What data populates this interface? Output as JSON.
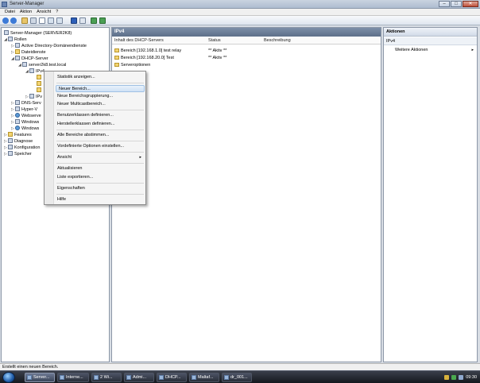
{
  "window": {
    "title": "Server-Manager"
  },
  "menubar": [
    "Datei",
    "Aktion",
    "Ansicht",
    "?"
  ],
  "tree": {
    "items": [
      {
        "label": "Server-Manager (SERVER2K8)",
        "level": 0,
        "icon": "server-icon",
        "expander": ""
      },
      {
        "label": "Rollen",
        "level": 1,
        "icon": "roles-icon",
        "expander": "◢"
      },
      {
        "label": "Active Directory-Domänendienste",
        "level": 2,
        "icon": "ad-icon",
        "expander": "▷"
      },
      {
        "label": "Dateidienste",
        "level": 2,
        "icon": "folder-icon",
        "expander": "▷"
      },
      {
        "label": "DHCP-Server",
        "level": 2,
        "icon": "dhcp-icon",
        "expander": "◢"
      },
      {
        "label": "server2k8.test.local",
        "level": 3,
        "icon": "computer-icon",
        "expander": "◢"
      },
      {
        "label": "IPv4",
        "level": 4,
        "icon": "ipv4-icon",
        "expander": "◢"
      },
      {
        "label": "IPv",
        "level": 4,
        "icon": "ipv6-icon",
        "expander": "▷"
      },
      {
        "label": "DNS-Serv",
        "level": 2,
        "icon": "dns-icon",
        "expander": "▷"
      },
      {
        "label": "Hyper-V",
        "level": 2,
        "icon": "hyperv-icon",
        "expander": "▷"
      },
      {
        "label": "Webserve",
        "level": 2,
        "icon": "web-icon",
        "expander": "▷"
      },
      {
        "label": "Windows",
        "level": 2,
        "icon": "windows-icon",
        "expander": "▷"
      },
      {
        "label": "Windows",
        "level": 2,
        "icon": "windows-icon",
        "expander": "▷"
      },
      {
        "label": "Features",
        "level": 1,
        "icon": "features-icon",
        "expander": "▷"
      },
      {
        "label": "Diagnose",
        "level": 1,
        "icon": "diagnose-icon",
        "expander": "▷"
      },
      {
        "label": "Konfiguration",
        "level": 1,
        "icon": "config-icon",
        "expander": "▷"
      },
      {
        "label": "Speicher",
        "level": 1,
        "icon": "storage-icon",
        "expander": "▷"
      }
    ]
  },
  "center": {
    "header": "IPv4",
    "columns": [
      "Inhalt des DHCP-Servers",
      "Status",
      "Beschreibung"
    ],
    "rows": [
      {
        "name": "Bereich [192.168.1.0] test relay",
        "status": "** Aktiv **"
      },
      {
        "name": "Bereich [192.168.20.0] Test",
        "status": "** Aktiv **"
      },
      {
        "name": "Serveroptionen",
        "status": ""
      }
    ]
  },
  "actions": {
    "title": "Aktionen",
    "section": "IPv4",
    "item": "Weitere Aktionen"
  },
  "context_menu": {
    "items": [
      {
        "label": "Statistik anzeigen...",
        "sep_before": false,
        "submenu": false
      },
      {
        "label": "Neuer Bereich...",
        "sep_before": true,
        "submenu": false,
        "highlight": true
      },
      {
        "label": "Neue Bereichsgruppierung...",
        "sep_before": false,
        "submenu": false
      },
      {
        "label": "Neuer Multicastbereich...",
        "sep_before": false,
        "submenu": false
      },
      {
        "label": "Benutzerklassen definieren...",
        "sep_before": true,
        "submenu": false
      },
      {
        "label": "Herstellerklassen definieren...",
        "sep_before": false,
        "submenu": false
      },
      {
        "label": "Alle Bereiche abstimmen...",
        "sep_before": true,
        "submenu": false
      },
      {
        "label": "Vordefinierte Optionen einstellen...",
        "sep_before": true,
        "submenu": false
      },
      {
        "label": "Ansicht",
        "sep_before": true,
        "submenu": true
      },
      {
        "label": "Aktualisieren",
        "sep_before": true,
        "submenu": false
      },
      {
        "label": "Liste exportieren...",
        "sep_before": false,
        "submenu": false
      },
      {
        "label": "Eigenschaften",
        "sep_before": true,
        "submenu": false
      },
      {
        "label": "Hilfe",
        "sep_before": true,
        "submenu": false
      }
    ]
  },
  "statusbar": "Erstellt einen neuen Bereich.",
  "taskbar": {
    "tasks": [
      "Server...",
      "Interne...",
      "2 Wi...",
      "Admi...",
      "DHCP...",
      "Maltaf...",
      "dr_001..."
    ],
    "clock": "09:30"
  },
  "colors": {
    "accent": "#5d6f89",
    "highlight": "#cfe1f5",
    "folder": "#f3d472"
  }
}
